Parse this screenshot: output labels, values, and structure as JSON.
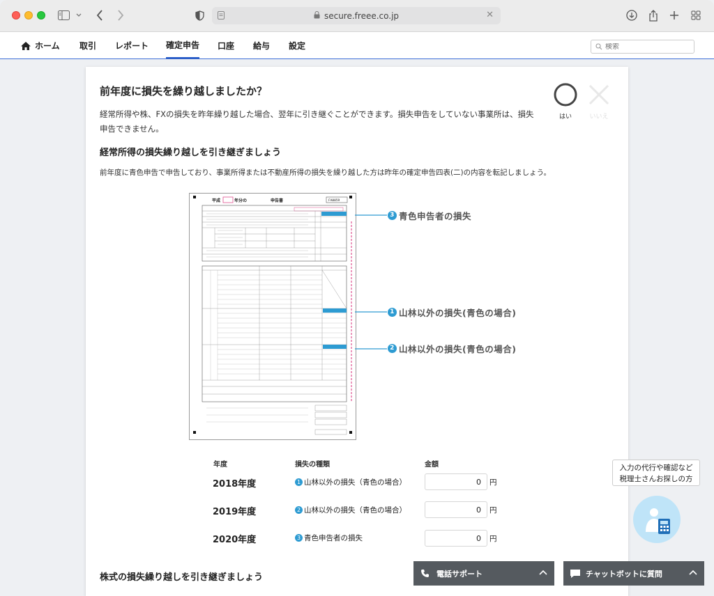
{
  "browser": {
    "url": "secure.freee.co.jp"
  },
  "nav": {
    "items": [
      {
        "label": "ホーム"
      },
      {
        "label": "取引"
      },
      {
        "label": "レポート"
      },
      {
        "label": "確定申告"
      },
      {
        "label": "口座"
      },
      {
        "label": "給与"
      },
      {
        "label": "設定"
      }
    ],
    "active": "確定申告",
    "search_placeholder": "検索"
  },
  "page": {
    "title": "前年度に損失を繰り越しましたか？",
    "description": "経常所得や株、FXの損失を昨年繰り越した場合、翌年に引き継ぐことができます。損失申告をしていない事業所は、損失申告できません。",
    "yes_label": "はい",
    "no_label": "いいえ",
    "section1_title": "経常所得の損失繰り越しを引き継ぎましょう",
    "section1_desc": "前年度に青色申告で申告しており、事業所得または不動産所得の損失を繰り越した方は昨年の確定申告四表(二)の内容を転記しましょう。",
    "section2_title": "株式の損失繰り越しを引き継ぎましょう"
  },
  "form_image": {
    "header_prefix": "平成",
    "header_mid": "年分の",
    "header_suffix": "申告書",
    "form_code": "FA0059",
    "callouts": [
      {
        "num": "3",
        "label": "青色申告者の損失"
      },
      {
        "num": "1",
        "label": "山林以外の損失(青色の場合)"
      },
      {
        "num": "2",
        "label": "山林以外の損失(青色の場合)"
      }
    ]
  },
  "loss_table": {
    "col_year": "年度",
    "col_type": "損失の種類",
    "col_amount": "金額",
    "currency": "円",
    "rows": [
      {
        "year": "2018年度",
        "num": "1",
        "type": "山林以外の損失（青色の場合）",
        "amount": "0"
      },
      {
        "year": "2019年度",
        "num": "2",
        "type": "山林以外の損失（青色の場合）",
        "amount": "0"
      },
      {
        "year": "2020年度",
        "num": "3",
        "type": "青色申告者の損失",
        "amount": "0"
      }
    ]
  },
  "widget": {
    "tooltip_line1": "入力の代行や確認など",
    "tooltip_line2": "税理士さんお探しの方"
  },
  "bottom": {
    "phone_label": "電話サポート",
    "chat_label": "チャットボットに質問"
  },
  "colors": {
    "accent": "#2c5ec8",
    "callout_blue": "#2d9bd2",
    "bottom_bar": "#555a5f"
  }
}
